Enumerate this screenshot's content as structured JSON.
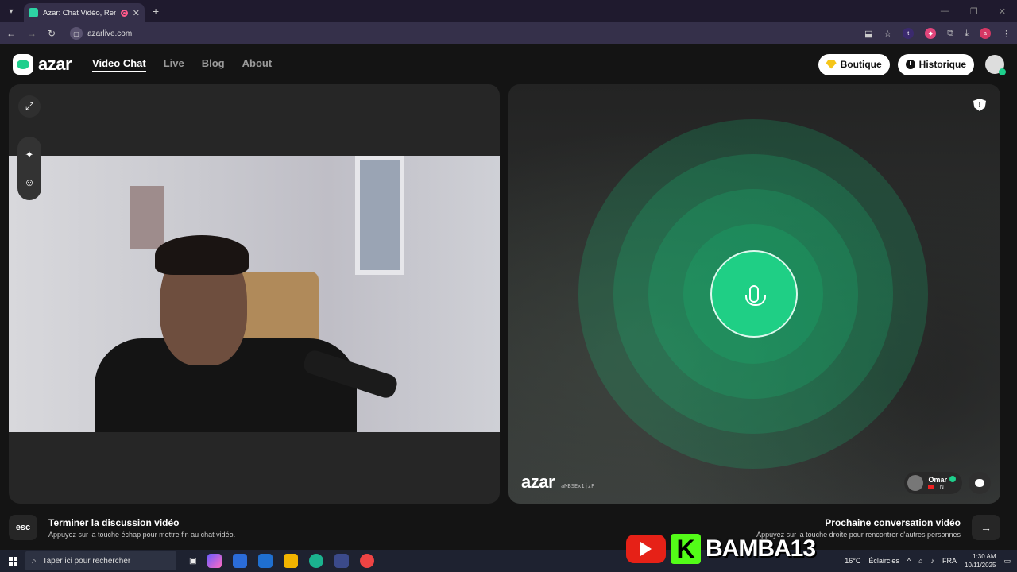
{
  "browser": {
    "tab_title": "Azar: Chat Vidéo, Rencontre",
    "url": "azarlive.com"
  },
  "nav": {
    "logo": "azar",
    "links": [
      {
        "label": "Video Chat",
        "active": true
      },
      {
        "label": "Live",
        "active": false
      },
      {
        "label": "Blog",
        "active": false
      },
      {
        "label": "About",
        "active": false
      }
    ],
    "boutique_label": "Boutique",
    "historique_label": "Historique"
  },
  "partner": {
    "watermark": "azar",
    "watermark_id": "aMBSEx1jzF",
    "name": "Omar",
    "country": "TN"
  },
  "hints": {
    "left_key": "esc",
    "left_title": "Terminer la discussion vidéo",
    "left_sub": "Appuyez sur la touche échap pour mettre fin au chat vidéo.",
    "right_title": "Prochaine conversation vidéo",
    "right_sub": "Appuyez sur la touche droite pour rencontrer d'autres personnes",
    "right_key": "→"
  },
  "overlay": {
    "brand_name": "BAMBA13",
    "kick_letter": "K"
  },
  "taskbar": {
    "search_placeholder": "Taper ici pour rechercher",
    "weather": "Éclaircies",
    "temp": "16°C",
    "lang": "FRA",
    "time": "1:30 AM",
    "date": "10/11/2025"
  },
  "colors": {
    "accent_green": "#1ecf8c",
    "ring_green": "#16be78",
    "youtube_red": "#e62117",
    "kick_green": "#53fc18"
  }
}
